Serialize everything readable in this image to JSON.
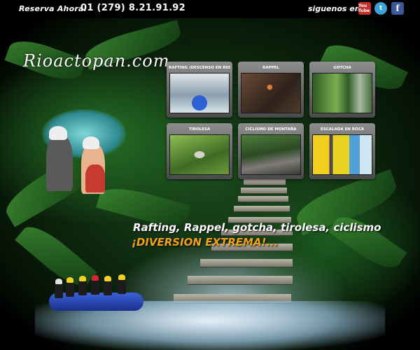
{
  "header": {
    "reserva_label": "Reserva Ahora:",
    "phone": "01 (279) 8.21.91.92",
    "social_label": "siguenos en:",
    "social": [
      {
        "name": "youtube",
        "label": "You Tube",
        "color": "#c4302b"
      },
      {
        "name": "twitter",
        "label": "t",
        "color": "#3aa3d8"
      },
      {
        "name": "facebook",
        "label": "f",
        "color": "#3b5998"
      }
    ]
  },
  "logo": "Rioactopan.com",
  "activities": [
    {
      "label": "RAFTING (DESCENSO EN RIO)"
    },
    {
      "label": "RAPPEL"
    },
    {
      "label": "GOTCHA"
    },
    {
      "label": "TIROLESA"
    },
    {
      "label": "CICLISMO DE MONTAÑA"
    },
    {
      "label": "ESCALADA EN ROCA"
    }
  ],
  "tagline": {
    "line1": "Rafting, Rappel, gotcha, tirolesa, ciclismo",
    "line2": "¡DIVERSION EXTREMA!..."
  },
  "colors": {
    "accent": "#f2a218",
    "card": "#6d6d6d",
    "background": "#000000"
  }
}
